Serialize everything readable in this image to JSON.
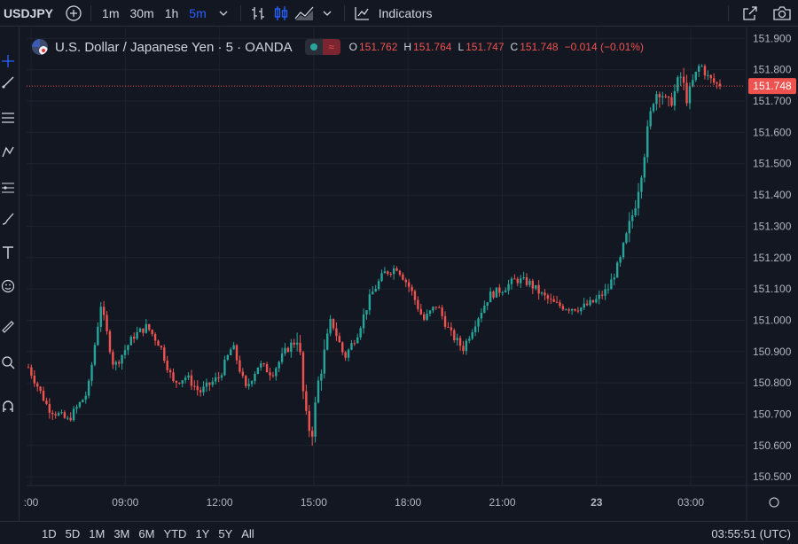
{
  "toolbar": {
    "symbol": "USDJPY",
    "intervals": [
      "1m",
      "30m",
      "1h",
      "5m"
    ],
    "active_interval": "5m",
    "indicators_label": "Indicators"
  },
  "legend": {
    "title": "U.S. Dollar / Japanese Yen · 5 · OANDA",
    "open_label": "O",
    "open": "151.762",
    "high_label": "H",
    "high": "151.764",
    "low_label": "L",
    "low": "151.747",
    "close_label": "C",
    "close": "151.748",
    "change": "−0.014 (−0.01%)",
    "up_color": "#26a69a",
    "down_color": "#ef5350"
  },
  "bottom": {
    "ranges": [
      "1D",
      "5D",
      "1M",
      "3M",
      "6M",
      "YTD",
      "1Y",
      "5Y",
      "All"
    ],
    "clock": "03:55:51 (UTC)"
  },
  "chart_data": {
    "type": "candlestick",
    "timeframe": "5",
    "x_tick_labels": [
      ":00",
      "09:00",
      "12:00",
      "15:00",
      "18:00",
      "21:00",
      "23",
      "03:00"
    ],
    "y_tick_labels": [
      "151.900",
      "151.800",
      "151.700",
      "151.600",
      "151.500",
      "151.400",
      "151.300",
      "151.200",
      "151.100",
      "151.000",
      "150.900",
      "150.800",
      "150.700",
      "150.600",
      "150.500"
    ],
    "ylim": [
      150.475,
      151.935
    ],
    "last_price": "151.748",
    "last_price_value": 151.748,
    "grid": true,
    "path": [
      [
        0,
        150.85
      ],
      [
        3,
        150.72
      ],
      [
        6,
        150.68
      ],
      [
        9,
        150.77
      ],
      [
        11,
        151.05
      ],
      [
        13,
        150.85
      ],
      [
        16,
        150.95
      ],
      [
        18,
        150.98
      ],
      [
        20,
        150.92
      ],
      [
        22,
        150.8
      ],
      [
        24,
        150.82
      ],
      [
        26,
        150.77
      ],
      [
        29,
        150.82
      ],
      [
        31,
        150.92
      ],
      [
        33,
        150.78
      ],
      [
        35,
        150.86
      ],
      [
        37,
        150.83
      ],
      [
        39,
        150.9
      ],
      [
        41,
        150.95
      ],
      [
        42,
        150.7
      ],
      [
        43,
        150.63
      ],
      [
        44,
        150.8
      ],
      [
        46,
        151.0
      ],
      [
        48,
        150.88
      ],
      [
        50,
        150.96
      ],
      [
        52,
        151.08
      ],
      [
        54,
        151.15
      ],
      [
        56,
        151.17
      ],
      [
        58,
        151.1
      ],
      [
        60,
        151.0
      ],
      [
        62,
        151.05
      ],
      [
        64,
        150.96
      ],
      [
        66,
        150.91
      ],
      [
        68,
        151.0
      ],
      [
        70,
        151.08
      ],
      [
        72,
        151.1
      ],
      [
        74,
        151.13
      ],
      [
        76,
        151.12
      ],
      [
        78,
        151.08
      ],
      [
        80,
        151.05
      ],
      [
        82,
        151.04
      ],
      [
        84,
        151.04
      ],
      [
        86,
        151.06
      ],
      [
        88,
        151.1
      ],
      [
        90,
        151.2
      ],
      [
        92,
        151.36
      ],
      [
        93,
        151.47
      ],
      [
        94,
        151.6
      ],
      [
        95,
        151.72
      ],
      [
        96,
        151.74
      ],
      [
        97,
        151.68
      ],
      [
        98,
        151.72
      ],
      [
        99,
        151.78
      ],
      [
        100,
        151.71
      ],
      [
        101,
        151.77
      ],
      [
        102,
        151.82
      ],
      [
        103,
        151.78
      ],
      [
        104,
        151.76
      ],
      [
        105,
        151.748
      ]
    ]
  }
}
